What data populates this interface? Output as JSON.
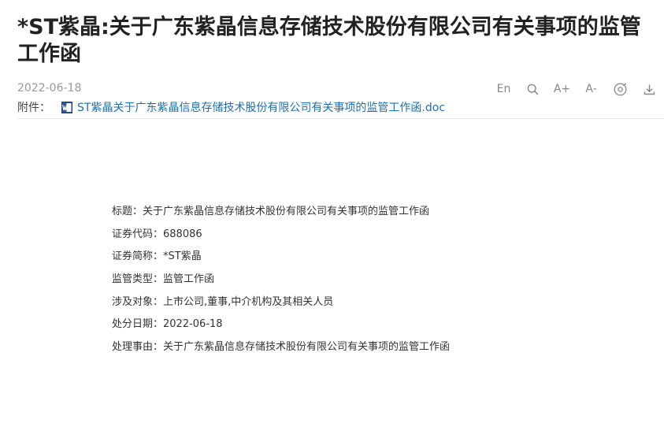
{
  "article": {
    "title": "*ST紫晶:关于广东紫晶信息存储技术股份有限公司有关事项的监管工作函",
    "date": "2022-06-18"
  },
  "toolbar": {
    "lang_label": "En",
    "zoom_in_label": "A+",
    "zoom_out_label": "A-",
    "icons": [
      "search-icon",
      "audio-icon",
      "download-icon"
    ]
  },
  "attachment": {
    "label": "附件：",
    "filename": "ST紫晶关于广东紫晶信息存储技术股份有限公司有关事项的监管工作函.doc",
    "link_color": "#1c6fad"
  },
  "details": [
    {
      "label": "标题：",
      "value": "关于广东紫晶信息存储技术股份有限公司有关事项的监管工作函"
    },
    {
      "label": "证券代码：",
      "value": "688086"
    },
    {
      "label": "证券简称：",
      "value": "*ST紫晶"
    },
    {
      "label": "监管类型：",
      "value": "监管工作函"
    },
    {
      "label": "涉及对象：",
      "value": "上市公司,董事,中介机构及其相关人员"
    },
    {
      "label": "处分日期：",
      "value": "2022-06-18"
    },
    {
      "label": "处理事由：",
      "value": "关于广东紫晶信息存储技术股份有限公司有关事项的监管工作函"
    }
  ]
}
